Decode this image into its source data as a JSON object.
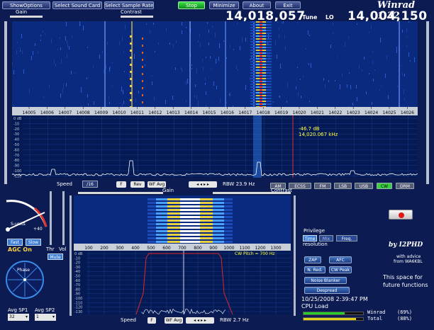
{
  "toolbar": {
    "show_options": "ShowOptions",
    "select_sound_card": "Select Sound Card",
    "select_sample_rate": "Select Sample Rate",
    "stop": "Stop",
    "minimize": "Minimize",
    "about": "About",
    "exit": "Exit"
  },
  "app_title": "Winrad 1.32",
  "freq": {
    "tune_value": "14,018,057",
    "tune_label": "Tune",
    "lo_label": "LO",
    "lo_value": "14,004,150"
  },
  "top": {
    "gain_label": "Gain",
    "contrast_label": "Contrast",
    "scale_ticks": [
      "14005",
      "14006",
      "14007",
      "14008",
      "14009",
      "14010",
      "14011",
      "14012",
      "14013",
      "14014",
      "14015",
      "14016",
      "14017",
      "14018",
      "14019",
      "14020",
      "14021",
      "14022",
      "14023",
      "14024",
      "14025",
      "14026"
    ],
    "db_labels": [
      "0 dB",
      "-10",
      "-20",
      "-30",
      "-40",
      "-50",
      "-60",
      "-70",
      "-80",
      "-90",
      "-100",
      "-110"
    ],
    "marker_db": "-46.7 dB",
    "marker_freq": "14,020.067 kHz"
  },
  "speed_bar": {
    "speed_label": "Speed",
    "speed_value": "/16",
    "f_label": "F",
    "rev_label": "Rev",
    "wf_avg_label": "WF Avg",
    "rbw_label": "RBW 23.9 Hz"
  },
  "modes": [
    "AM",
    "ECSS",
    "FM",
    "LSB",
    "USB",
    "CW",
    "DRM"
  ],
  "left": {
    "s_units_label": "S-units",
    "s_plus": "+40",
    "fast_label": "Fast",
    "slow_label": "Slow",
    "agc_label": "AGC On",
    "thr_label": "Thr",
    "vol_label": "Vol",
    "mute_label": "Mute",
    "phase_label": "Phase",
    "avg_sp1_label": "Avg SP1",
    "avg_sp2_label": "Avg SP2",
    "avg_sp1_value": "32",
    "avg_sp2_value": "1"
  },
  "bottom": {
    "gain_label": "Gain",
    "contrast_label": "Contrast",
    "scale_ticks": [
      "100",
      "200",
      "300",
      "400",
      "500",
      "600",
      "700",
      "800",
      "900",
      "1000",
      "1100",
      "1200",
      "1300"
    ],
    "db_labels": [
      "0 dB",
      "-10",
      "-20",
      "-30",
      "-40",
      "-50",
      "-60",
      "-70",
      "-80",
      "-90",
      "-100",
      "-110",
      "-120",
      "-130"
    ],
    "cw_pitch": "CW Pitch = 700 Hz",
    "speed_label": "Speed",
    "f_label": "F",
    "wf_avg_label": "WF Avg",
    "rbw_label": "RBW  2.7 Hz"
  },
  "right": {
    "privilege_label": "Privilege",
    "time_label": "Time",
    "mix_label": "Mix",
    "freq_label": "Freq.",
    "resolution_label": "resolution",
    "zap": "ZAP",
    "afc": "AFC",
    "n_red": "N. Red.",
    "cw_peak": "CW Peak",
    "noise_blanker": "Noise Blanker",
    "despread": "Despread",
    "by": "by I2PHD",
    "advice": "with advice",
    "advice2": "from WA6KBL",
    "space1": "This space for",
    "space2": "future functions",
    "datetime": "10/25/2008 2:39:47 PM",
    "cpu_label": "CPU Load",
    "winrad_label": "Winrad",
    "winrad_pct": "(69%)",
    "total_label": "Total",
    "total_pct": "(88%)",
    "winrad_load": 0.69,
    "total_load": 0.88
  }
}
